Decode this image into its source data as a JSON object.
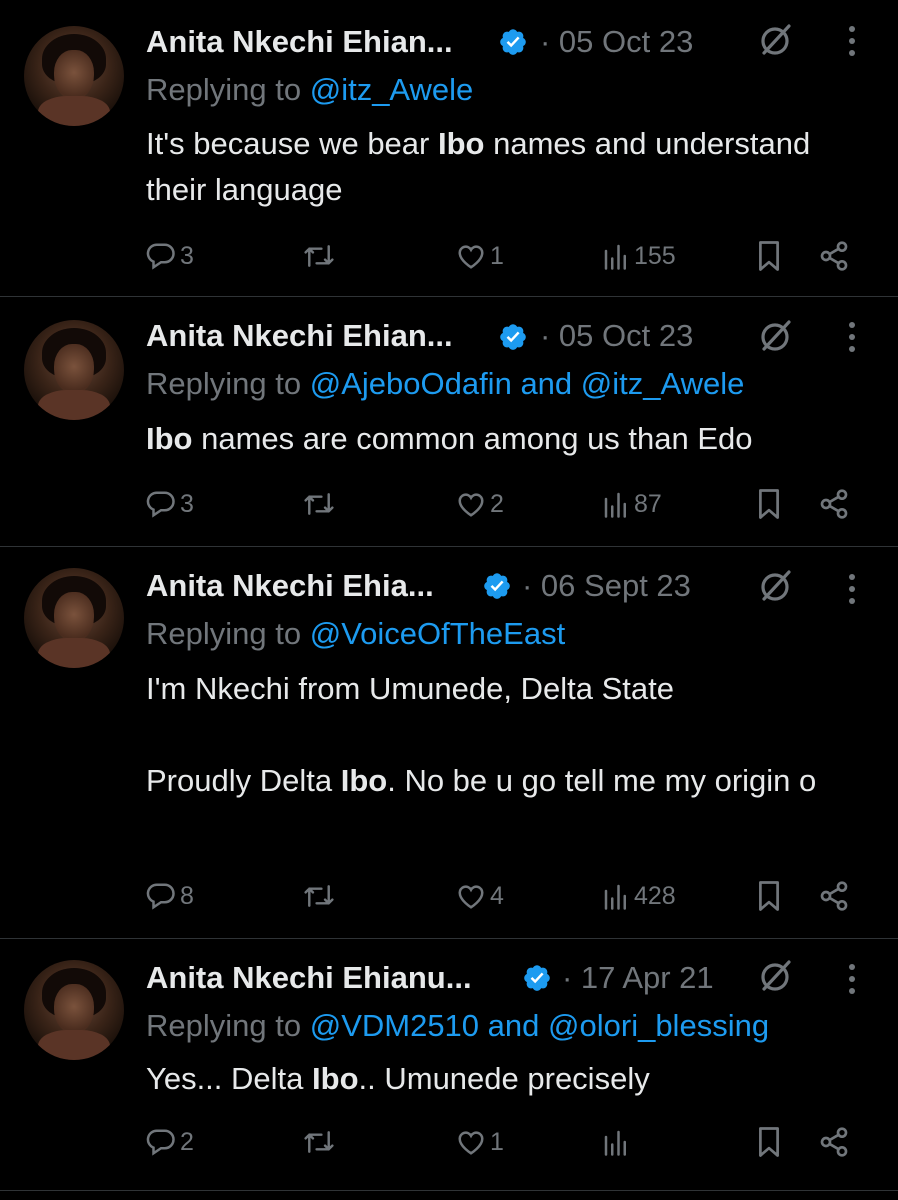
{
  "tweets": [
    {
      "author": "Anita Nkechi Ehian...",
      "date": "· 05 Oct 23",
      "reply_prefix": "Replying to",
      "reply_handles": [
        "@itz_Awele"
      ],
      "reply_joiner": "",
      "text_segments": [
        {
          "t": "It's because we bear ",
          "b": false
        },
        {
          "t": "Ibo",
          "b": true
        },
        {
          "t": " names and understand their language",
          "b": false
        }
      ],
      "replies": "3",
      "reposts": "",
      "likes": "1",
      "views": "155"
    },
    {
      "author": "Anita Nkechi Ehian...",
      "date": "· 05 Oct 23",
      "reply_prefix": "Replying to",
      "reply_handles": [
        "@AjeboOdafin",
        "@itz_Awele"
      ],
      "reply_joiner": "and",
      "text_segments": [
        {
          "t": "Ibo",
          "b": true
        },
        {
          "t": " names are common among us than Edo",
          "b": false
        }
      ],
      "replies": "3",
      "reposts": "",
      "likes": "2",
      "views": "87"
    },
    {
      "author": "Anita Nkechi Ehia...",
      "date": "· 06 Sept 23",
      "reply_prefix": "Replying to",
      "reply_handles": [
        "@VoiceOfTheEast"
      ],
      "reply_joiner": "",
      "text_segments": [
        {
          "t": "I'm Nkechi from Umunede, Delta State",
          "b": false
        },
        {
          "t": "\n\n",
          "b": false
        },
        {
          "t": "Proudly Delta ",
          "b": false
        },
        {
          "t": "Ibo",
          "b": true
        },
        {
          "t": ". No be u go tell me my origin o",
          "b": false
        }
      ],
      "replies": "8",
      "reposts": "",
      "likes": "4",
      "views": "428"
    },
    {
      "author": "Anita Nkechi Ehianu...",
      "date": "· 17 Apr 21",
      "reply_prefix": "Replying to",
      "reply_handles": [
        "@VDM2510",
        "@olori_blessing"
      ],
      "reply_joiner": "and",
      "text_segments": [
        {
          "t": "Yes... Delta ",
          "b": false
        },
        {
          "t": "Ibo",
          "b": true
        },
        {
          "t": ".. Umunede precisely",
          "b": false
        }
      ],
      "replies": "2",
      "reposts": "",
      "likes": "1",
      "views": ""
    }
  ],
  "icons": {
    "verified": "verified-badge-icon",
    "grok": "grok-icon",
    "more": "more-vertical-icon",
    "reply": "reply-icon",
    "repost": "repost-icon",
    "like": "like-icon",
    "views": "views-icon",
    "bookmark": "bookmark-icon",
    "share": "share-icon"
  },
  "colors": {
    "background": "#000000",
    "text": "#e7e9ea",
    "secondary": "#71767b",
    "link": "#1d9bf0",
    "divider": "#2f3336"
  }
}
